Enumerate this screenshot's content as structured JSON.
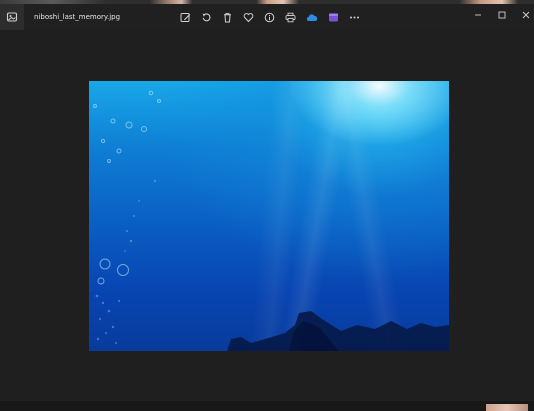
{
  "window": {
    "filename": "niboshi_last_memory.jpg"
  },
  "toolbar": {
    "items": [
      {
        "icon": "edit-image-icon"
      },
      {
        "icon": "rotate-icon"
      },
      {
        "icon": "delete-icon"
      },
      {
        "icon": "favorite-icon"
      },
      {
        "icon": "info-icon"
      },
      {
        "icon": "print-icon"
      },
      {
        "icon": "onedrive-icon"
      },
      {
        "icon": "clipchamp-icon"
      },
      {
        "icon": "more-icon"
      }
    ]
  },
  "window_controls": [
    "minimize-icon",
    "maximize-icon",
    "close-icon"
  ],
  "colors": {
    "background": "#1f1f1f",
    "titlebar": "#202020",
    "icon": "#d0d0d0",
    "onedrive": "#2f8be6",
    "clipchamp": "#7b4fd6"
  }
}
